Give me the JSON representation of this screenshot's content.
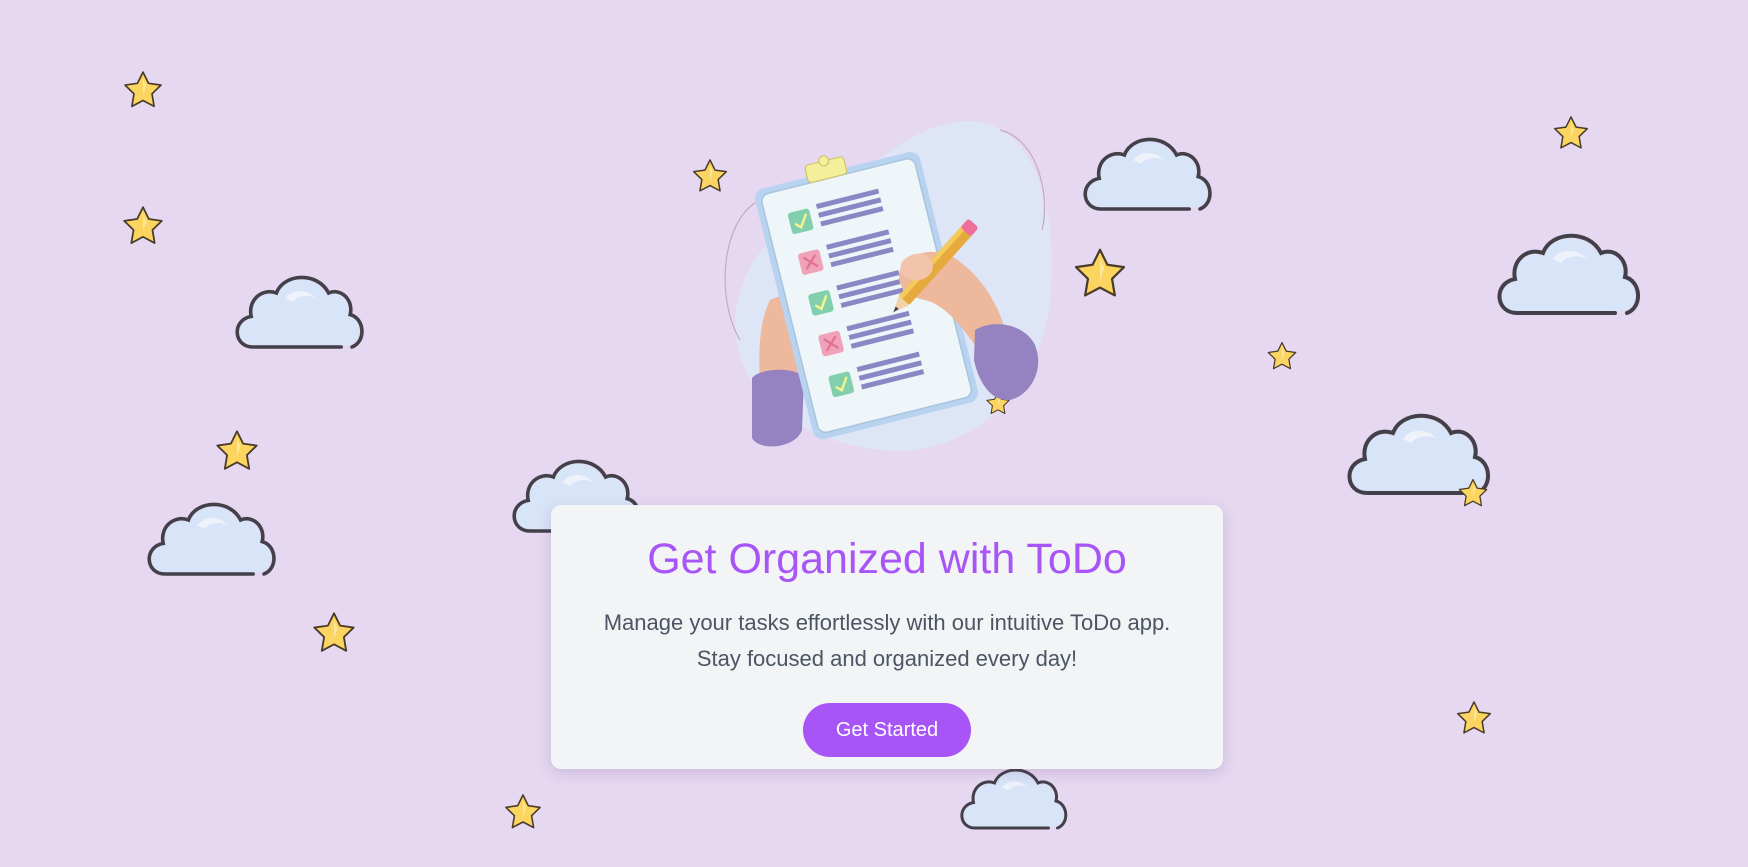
{
  "hero": {
    "title": "Get Organized with ToDo",
    "description_line1": "Manage your tasks effortlessly with our intuitive ToDo app.",
    "description_line2": "Stay focused and organized every day!",
    "cta_label": "Get Started"
  },
  "colors": {
    "background": "#e6d8f1",
    "accent": "#a855f7",
    "card": "#f3f4f6",
    "body_text": "#4b5563",
    "cloud_fill": "#d8e4f7",
    "cloud_stroke": "#44404a",
    "star_fill": "#fcd561",
    "star_stroke": "#4a3b2a"
  },
  "illustration": {
    "icon": "clipboard-checklist-icon",
    "items": [
      {
        "status": "checked",
        "icon": "check-icon"
      },
      {
        "status": "crossed",
        "icon": "cross-icon"
      },
      {
        "status": "checked",
        "icon": "check-icon"
      },
      {
        "status": "crossed",
        "icon": "cross-icon"
      },
      {
        "status": "checked",
        "icon": "check-icon"
      }
    ]
  }
}
